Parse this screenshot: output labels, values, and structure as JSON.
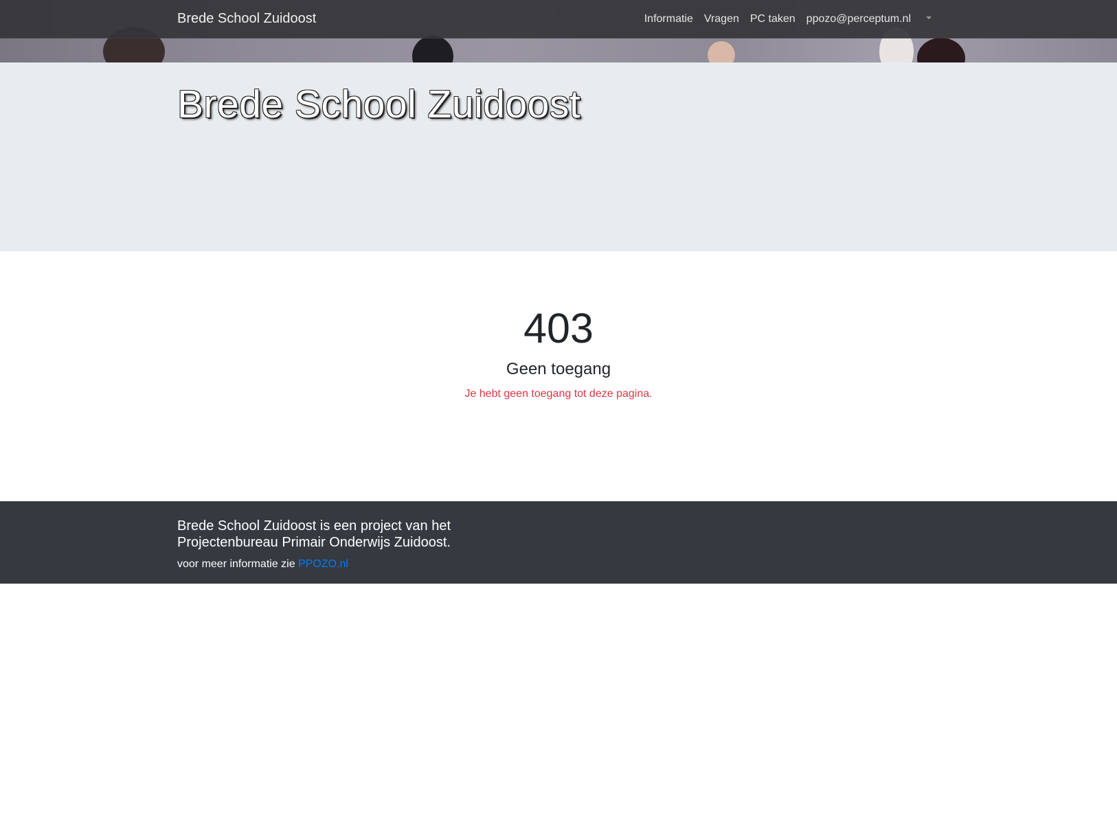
{
  "navbar": {
    "brand": "Brede School Zuidoost",
    "links": [
      "Informatie",
      "Vragen",
      "PC taken"
    ],
    "user": "ppozo@perceptum.nl"
  },
  "jumbotron": {
    "title": "Brede School Zuidoost"
  },
  "error": {
    "code": "403",
    "title": "Geen toegang",
    "message": "Je hebt geen toegang tot deze pagina."
  },
  "footer": {
    "lead": "Brede School Zuidoost is een project van het Projectenbureau Primair Onderwijs Zuidoost.",
    "info_prefix": "voor meer informatie zie",
    "link_text": "PPOZO.nl"
  },
  "colors": {
    "navbar_bg": "#343438",
    "jumbotron_bg": "#e9ecef",
    "error_message": "#dc3545",
    "footer_bg": "#343a40",
    "link": "#007bff"
  }
}
